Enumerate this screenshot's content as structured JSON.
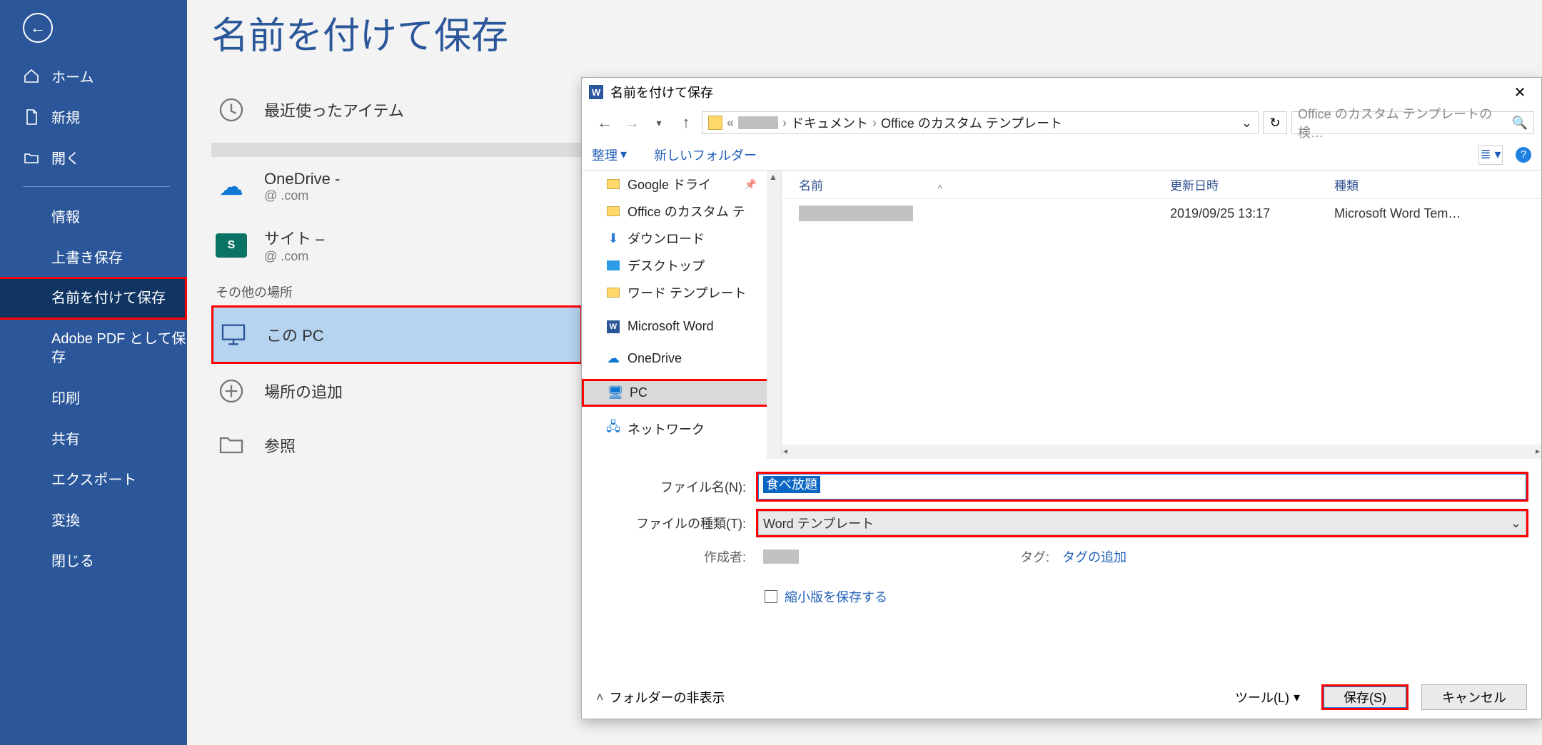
{
  "page": {
    "title": "名前を付けて保存"
  },
  "sidebar": {
    "home": "ホーム",
    "new": "新規",
    "open": "開く",
    "info": "情報",
    "save": "上書き保存",
    "saveas": "名前を付けて保存",
    "pdf": "Adobe PDF として保存",
    "print": "印刷",
    "share": "共有",
    "export": "エクスポート",
    "convert": "変換",
    "close": "閉じる"
  },
  "locations": {
    "recent": "最近使ったアイテム",
    "onedrive_title": "OneDrive - ",
    "onedrive_sub": "@                  .com",
    "site_title": "サイト – ",
    "site_sub": "@                  .com",
    "other_header": "その他の場所",
    "this_pc": "この PC",
    "add_place": "場所の追加",
    "browse": "参照"
  },
  "dialog": {
    "title": "名前を付けて保存",
    "breadcrumb": {
      "p1": "ドキュメント",
      "p2": "Office のカスタム テンプレート",
      "sep": "›",
      "lead": "«"
    },
    "search_placeholder": "Office のカスタム テンプレートの検…",
    "toolbar": {
      "organize": "整理",
      "newfolder": "新しいフォルダー"
    },
    "tree": {
      "gdrive": "Google ドライ",
      "office_custom": "Office のカスタム テ",
      "downloads": "ダウンロード",
      "desktop": "デスクトップ",
      "word_tmpl": "ワード テンプレート",
      "msword": "Microsoft Word",
      "onedrive": "OneDrive",
      "pc": "PC",
      "network": "ネットワーク"
    },
    "columns": {
      "name": "名前",
      "date": "更新日時",
      "type": "種類"
    },
    "file_row": {
      "date": "2019/09/25 13:17",
      "type": "Microsoft Word Tem…"
    },
    "form": {
      "fn_label": "ファイル名(N):",
      "fn_value": "食べ放題",
      "ft_label": "ファイルの種類(T):",
      "ft_value": "Word テンプレート",
      "author_label": "作成者:",
      "tag_label": "タグ:",
      "tag_link": "タグの追加",
      "thumb": "縮小版を保存する"
    },
    "footer": {
      "hide_folders": "フォルダーの非表示",
      "tools": "ツール(L)",
      "save": "保存(S)",
      "cancel": "キャンセル"
    }
  }
}
